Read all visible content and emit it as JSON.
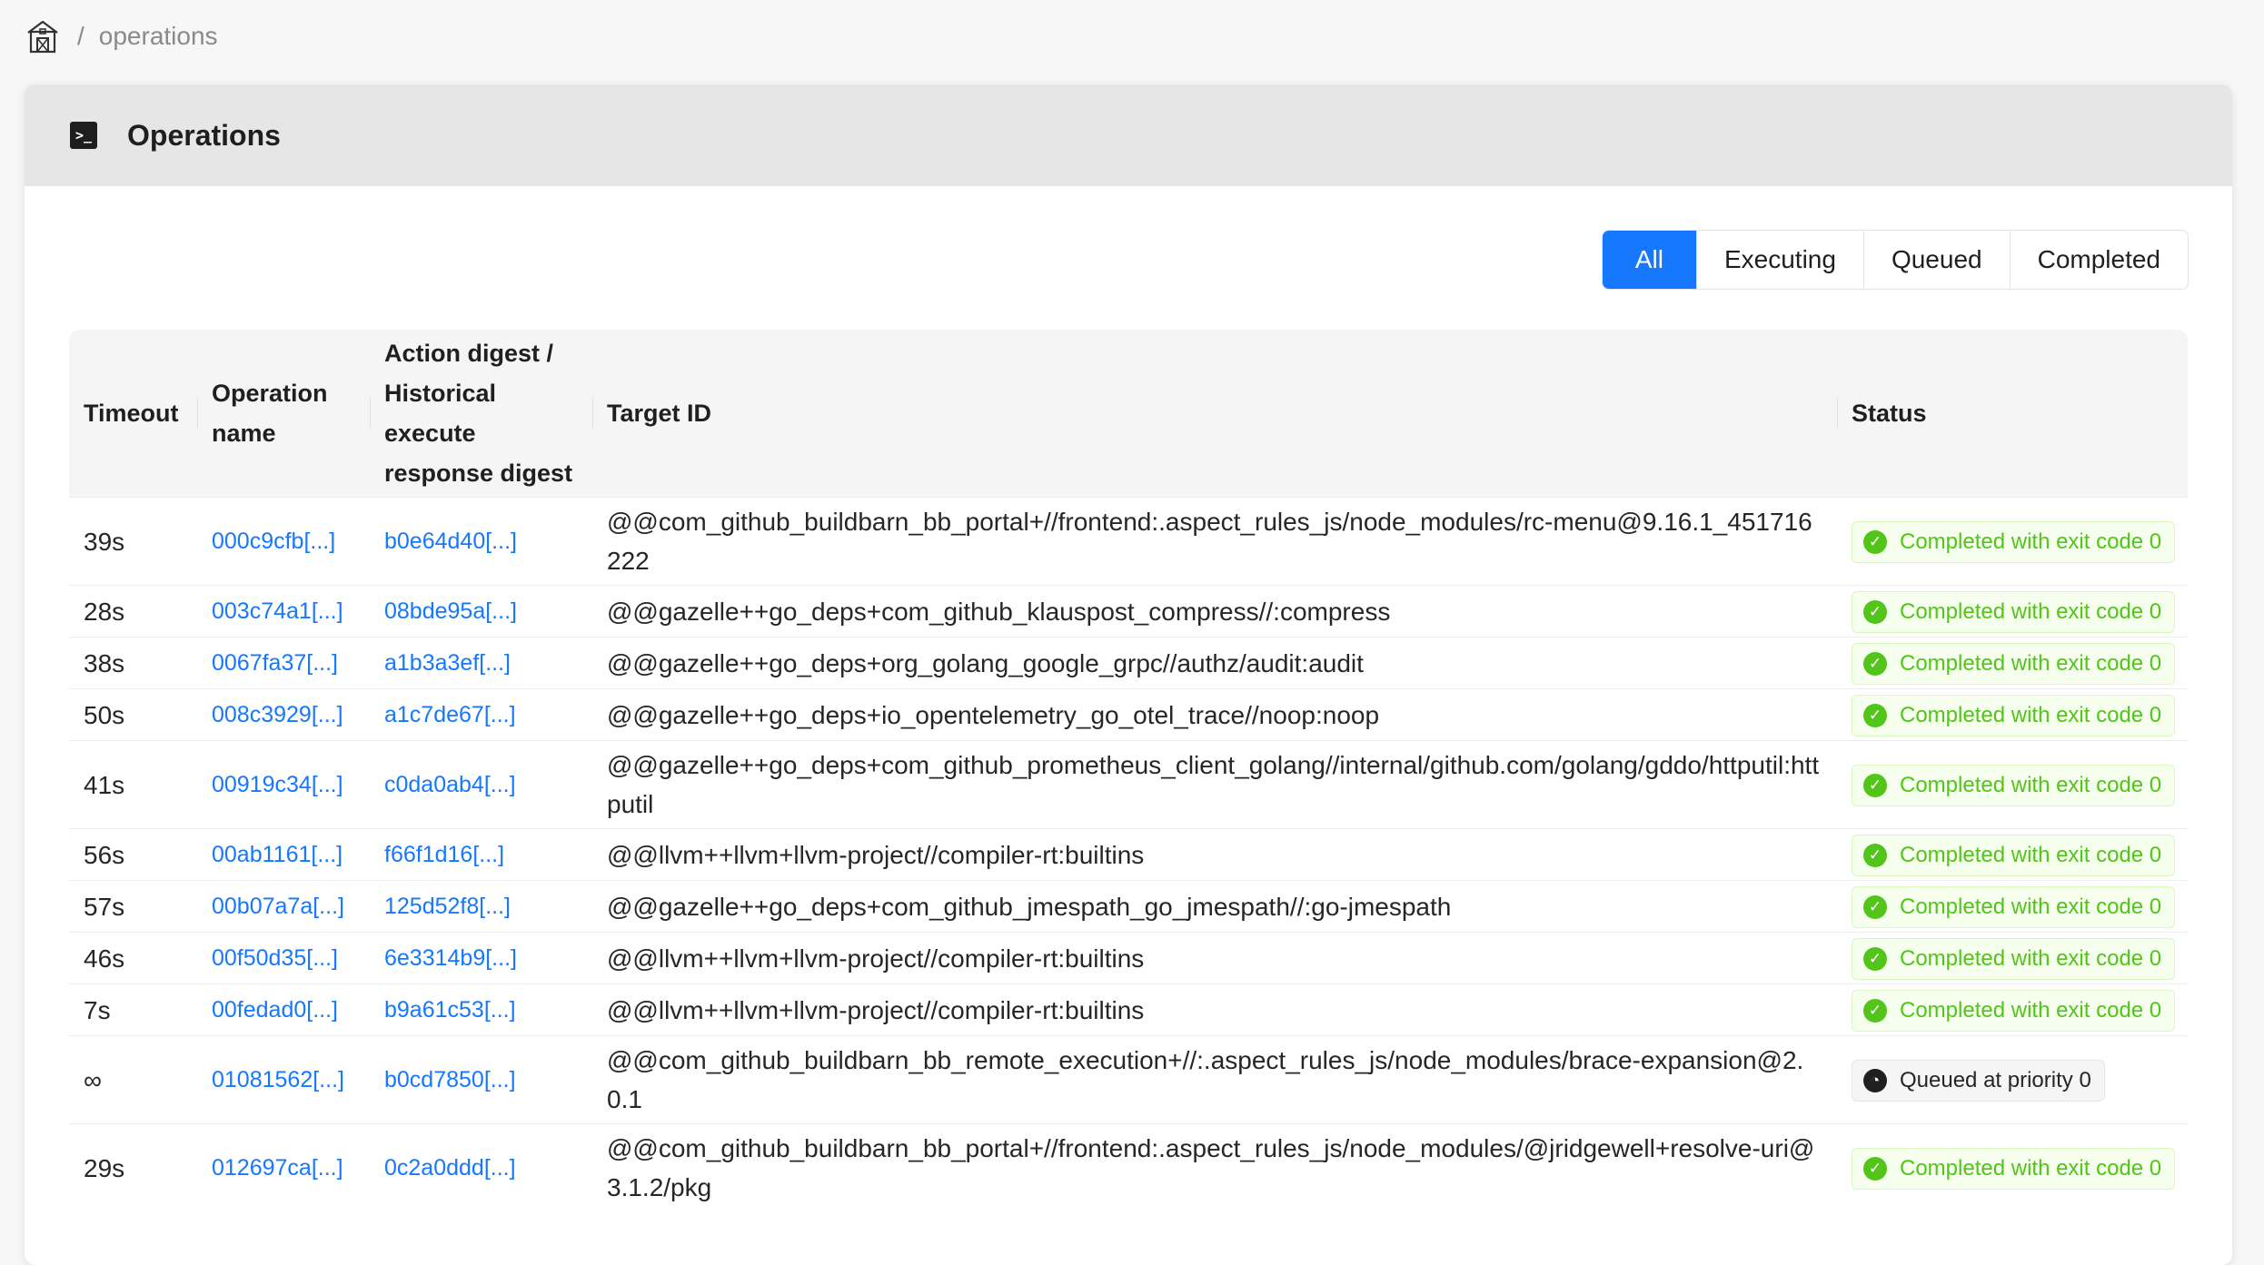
{
  "breadcrumb": {
    "separator": "/",
    "current": "operations"
  },
  "header": {
    "title": "Operations",
    "icon": "terminal-icon"
  },
  "filter": {
    "options": [
      "All",
      "Executing",
      "Queued",
      "Completed"
    ],
    "selected": "All"
  },
  "table": {
    "columns": {
      "timeout": "Timeout",
      "operation_name": "Operation name",
      "action_digest": "Action digest / Historical execute response digest",
      "target_id": "Target ID",
      "status": "Status"
    },
    "rows": [
      {
        "timeout": "39s",
        "operation": "000c9cfb[...]",
        "digest": "b0e64d40[...]",
        "target": "@@com_github_buildbarn_bb_portal+//frontend:.aspect_rules_js/node_modules/rc-menu@9.16.1_451716222",
        "status": "Completed with exit code 0",
        "kind": "ok"
      },
      {
        "timeout": "28s",
        "operation": "003c74a1[...]",
        "digest": "08bde95a[...]",
        "target": "@@gazelle++go_deps+com_github_klauspost_compress//:compress",
        "status": "Completed with exit code 0",
        "kind": "ok"
      },
      {
        "timeout": "38s",
        "operation": "0067fa37[...]",
        "digest": "a1b3a3ef[...]",
        "target": "@@gazelle++go_deps+org_golang_google_grpc//authz/audit:audit",
        "status": "Completed with exit code 0",
        "kind": "ok"
      },
      {
        "timeout": "50s",
        "operation": "008c3929[...]",
        "digest": "a1c7de67[...]",
        "target": "@@gazelle++go_deps+io_opentelemetry_go_otel_trace//noop:noop",
        "status": "Completed with exit code 0",
        "kind": "ok"
      },
      {
        "timeout": "41s",
        "operation": "00919c34[...]",
        "digest": "c0da0ab4[...]",
        "target": "@@gazelle++go_deps+com_github_prometheus_client_golang//internal/github.com/golang/gddo/httputil:httputil",
        "status": "Completed with exit code 0",
        "kind": "ok"
      },
      {
        "timeout": "56s",
        "operation": "00ab1161[...]",
        "digest": "f66f1d16[...]",
        "target": "@@llvm++llvm+llvm-project//compiler-rt:builtins",
        "status": "Completed with exit code 0",
        "kind": "ok"
      },
      {
        "timeout": "57s",
        "operation": "00b07a7a[...]",
        "digest": "125d52f8[...]",
        "target": "@@gazelle++go_deps+com_github_jmespath_go_jmespath//:go-jmespath",
        "status": "Completed with exit code 0",
        "kind": "ok"
      },
      {
        "timeout": "46s",
        "operation": "00f50d35[...]",
        "digest": "6e3314b9[...]",
        "target": "@@llvm++llvm+llvm-project//compiler-rt:builtins",
        "status": "Completed with exit code 0",
        "kind": "ok"
      },
      {
        "timeout": "7s",
        "operation": "00fedad0[...]",
        "digest": "b9a61c53[...]",
        "target": "@@llvm++llvm+llvm-project//compiler-rt:builtins",
        "status": "Completed with exit code 0",
        "kind": "ok"
      },
      {
        "timeout": "∞",
        "operation": "01081562[...]",
        "digest": "b0cd7850[...]",
        "target": "@@com_github_buildbarn_bb_remote_execution+//:.aspect_rules_js/node_modules/brace-expansion@2.0.1",
        "status": "Queued at priority 0",
        "kind": "queued"
      },
      {
        "timeout": "29s",
        "operation": "012697ca[...]",
        "digest": "0c2a0ddd[...]",
        "target": "@@com_github_buildbarn_bb_portal+//frontend:.aspect_rules_js/node_modules/@jridgewell+resolve-uri@3.1.2/pkg",
        "status": "Completed with exit code 0",
        "kind": "ok"
      }
    ]
  }
}
